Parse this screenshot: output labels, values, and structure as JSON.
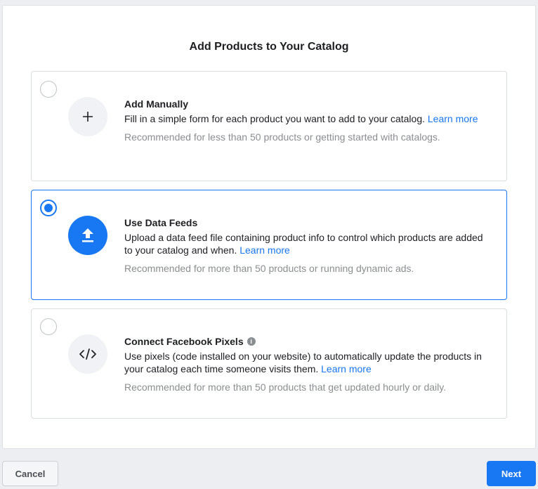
{
  "dialog": {
    "title": "Add Products to Your Catalog"
  },
  "options": [
    {
      "title": "Add Manually",
      "description": "Fill in a simple form for each product you want to add to your catalog.",
      "link": "Learn more",
      "recommendation": "Recommended for less than 50 products or getting started with catalogs.",
      "icon": "plus-icon",
      "selected": false
    },
    {
      "title": "Use Data Feeds",
      "description": "Upload a data feed file containing product info to control which products are added to your catalog and when.",
      "link": "Learn more",
      "recommendation": "Recommended for more than 50 products or running dynamic ads.",
      "icon": "upload-icon",
      "selected": true
    },
    {
      "title": "Connect Facebook Pixels",
      "description": "Use pixels (code installed on your website) to automatically update the products in your catalog each time someone visits them.",
      "link": "Learn more",
      "recommendation": "Recommended for more than 50 products that get updated hourly or daily.",
      "icon": "code-icon",
      "info_icon": "info-icon",
      "info_glyph": "i",
      "selected": false
    }
  ],
  "footer": {
    "cancel_label": "Cancel",
    "next_label": "Next"
  },
  "colors": {
    "accent": "#1877f2",
    "muted_text": "#8a8d91",
    "border": "#dadde1"
  }
}
